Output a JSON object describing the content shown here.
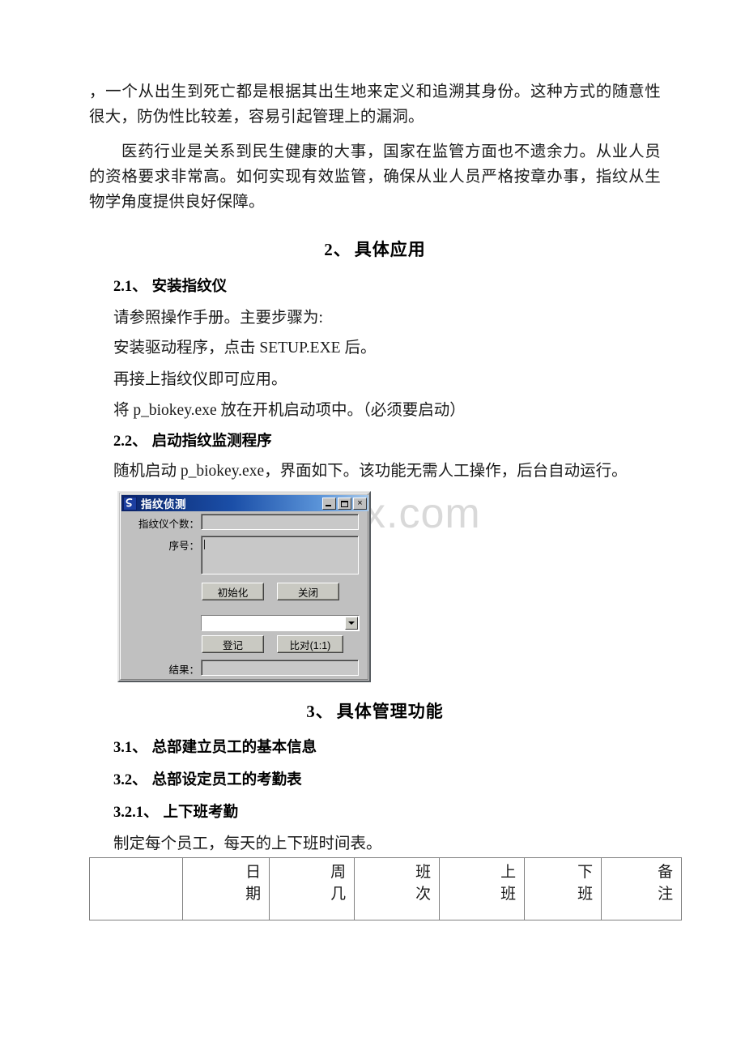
{
  "document": {
    "paragraphs": [
      "，一个从出生到死亡都是根据其出生地来定义和追溯其身份。这种方式的随意性很大，防伪性比较差，容易引起管理上的漏洞。",
      "医药行业是关系到民生健康的大事，国家在监管方面也不遗余力。从业人员的资格要求非常高。如何实现有效监管，确保从业人员严格按章办事，指纹从生物学角度提供良好保障。"
    ],
    "heading_2": {
      "num": "2、",
      "text": "具体应用"
    },
    "heading_2_1": {
      "num": "2.1、",
      "text": "安装指纹仪"
    },
    "lines_2_1": [
      "请参照操作手册。主要步骤为:",
      "安装驱动程序，点击 SETUP.EXE 后。",
      "再接上指纹仪即可应用。",
      "将 p_biokey.exe 放在开机启动项中。（必须要启动）"
    ],
    "heading_2_2": {
      "num": "2.2、",
      "text": "启动指纹监测程序"
    },
    "lines_2_2": [
      "随机启动 p_biokey.exe，界面如下。该功能无需人工操作，后台自动运行。"
    ],
    "heading_3": {
      "num": "3、",
      "text": "具体管理功能"
    },
    "heading_3_1": {
      "num": "3.1、",
      "text": "总部建立员工的基本信息"
    },
    "heading_3_2": {
      "num": "3.2、",
      "text": "总部设定员工的考勤表"
    },
    "heading_3_2_1": {
      "num": "3.2.1、",
      "text": "上下班考勤"
    },
    "lines_3_2_1": [
      "制定每个员工，每天的上下班时间表。"
    ]
  },
  "watermark": {
    "text": "www.bdocx.com",
    "color": "#d9d9d9"
  },
  "dialog": {
    "title": "指纹侦测",
    "icon": "app-fingerprint-icon",
    "titlebar_color": "#0a246a",
    "face_color": "#c0c0c0",
    "window_buttons": {
      "minimize": "minimize-icon",
      "maximize": "maximize-icon",
      "close": "×"
    },
    "fields": [
      {
        "label": "指纹仪个数：",
        "value": ""
      },
      {
        "label": "序号：",
        "value": ""
      },
      {
        "label": "结果：",
        "value": ""
      }
    ],
    "buttons": [
      {
        "label": "初始化"
      },
      {
        "label": "关闭"
      },
      {
        "label": "登记"
      },
      {
        "label": "比对(1:1)"
      }
    ],
    "combo": {
      "value": "",
      "options": []
    }
  },
  "schedule_table": {
    "headers": [
      "",
      "日期",
      "周几",
      "班次",
      "上班",
      "下班",
      "备注"
    ],
    "rows": []
  }
}
